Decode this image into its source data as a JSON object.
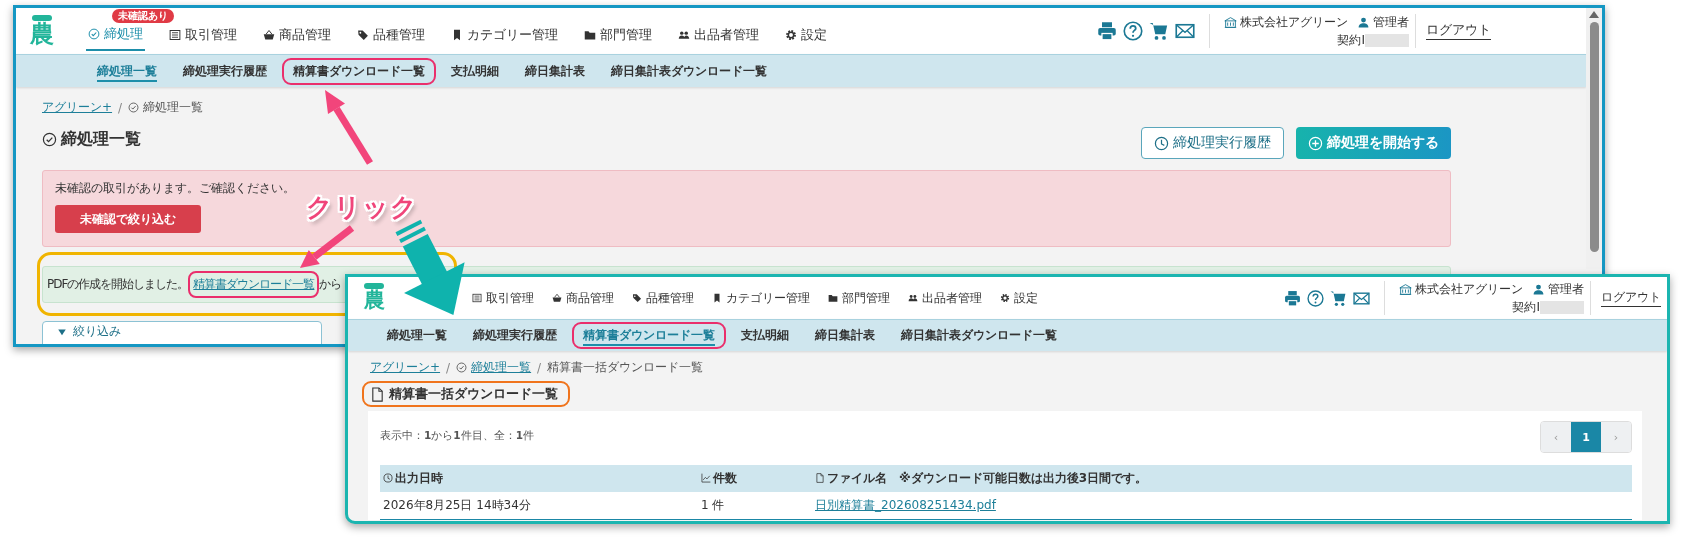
{
  "before_screen": {
    "header": {
      "logo": "農",
      "nav": [
        {
          "label": "締処理",
          "selected": true,
          "badge": "未確認あり"
        },
        {
          "label": "取引管理",
          "selected": false
        },
        {
          "label": "商品管理",
          "selected": false
        },
        {
          "label": "品種管理",
          "selected": false
        },
        {
          "label": "カテゴリー管理",
          "selected": false
        },
        {
          "label": "部門管理",
          "selected": false
        },
        {
          "label": "出品者管理",
          "selected": false
        },
        {
          "label": "設定",
          "selected": false
        }
      ],
      "company": "株式会社アグリーン",
      "role": "管理者",
      "contract_label": "契約I",
      "logout": "ログアウト"
    },
    "subnav": [
      {
        "label": "締処理一覧",
        "selected": true,
        "highlighted": false
      },
      {
        "label": "締処理実行履歴",
        "selected": false,
        "highlighted": false
      },
      {
        "label": "精算書ダウンロード一覧",
        "selected": false,
        "highlighted": true
      },
      {
        "label": "支払明細",
        "selected": false,
        "highlighted": false
      },
      {
        "label": "締日集計表",
        "selected": false,
        "highlighted": false
      },
      {
        "label": "締日集計表ダウンロード一覧",
        "selected": false,
        "highlighted": false
      }
    ],
    "breadcrumb": {
      "separator": "/",
      "items": [
        {
          "label": "アグリーン+",
          "link": true
        },
        {
          "label": "締処理一覧",
          "link": false
        }
      ]
    },
    "title": "締処理一覧",
    "buttons": [
      {
        "label": "締処理実行履歴",
        "kind": "history"
      },
      {
        "label": "締処理を開始する",
        "kind": "start"
      }
    ],
    "warning": {
      "message": "未確認の取引があります。ご確認ください。",
      "button": "未確認で絞り込む"
    },
    "notice": {
      "text": "PDFの作成を開始しました。",
      "link": "精算書ダウンロード一覧",
      "link_highlighted": true,
      "text_after": "から"
    },
    "filter": {
      "label": "絞り込み"
    }
  },
  "after_screen": {
    "header": {
      "logo": "農",
      "nav": [
        {
          "label": "取引管理",
          "selected": false
        },
        {
          "label": "商品管理",
          "selected": false
        },
        {
          "label": "品種管理",
          "selected": false
        },
        {
          "label": "カテゴリー管理",
          "selected": false
        },
        {
          "label": "部門管理",
          "selected": false
        },
        {
          "label": "出品者管理",
          "selected": false
        },
        {
          "label": "設定",
          "selected": false
        }
      ],
      "company": "株式会社アグリーン",
      "role": "管理者",
      "contract_label": "契約I",
      "logout": "ログアウト"
    },
    "subnav": [
      {
        "label": "締処理一覧",
        "selected": false,
        "highlighted": false
      },
      {
        "label": "締処理実行履歴",
        "selected": false,
        "highlighted": false
      },
      {
        "label": "精算書ダウンロード一覧",
        "selected": true,
        "highlighted": true
      },
      {
        "label": "支払明細",
        "selected": false,
        "highlighted": false
      },
      {
        "label": "締日集計表",
        "selected": false,
        "highlighted": false
      },
      {
        "label": "締日集計表ダウンロード一覧",
        "selected": false,
        "highlighted": false
      }
    ],
    "breadcrumb": {
      "separator": "/",
      "items": [
        {
          "label": "アグリーン+",
          "link": true
        },
        {
          "label": "締処理一覧",
          "link": true
        },
        {
          "label": "精算書一括ダウンロード一覧",
          "link": false
        }
      ]
    },
    "title": "精算書一括ダウンロード一覧",
    "title_highlighted": true,
    "summary": "表示中：**1**から**1**件目、全：**1**件",
    "pagination": {
      "prev": "‹",
      "pages": [
        {
          "label": "1",
          "selected": true
        }
      ],
      "next": "›"
    },
    "table": {
      "columns": [
        "出力日時",
        "件数",
        "ファイル名"
      ],
      "note": "※ダウンロード可能日数は出力後3日間です。",
      "rows": [
        {
          "date": "2026年8月25日 14時34分",
          "count": "1 件",
          "file": "日別精算書_202608251434.pdf"
        }
      ]
    }
  },
  "annotations": {
    "click_label": "クリック"
  }
}
